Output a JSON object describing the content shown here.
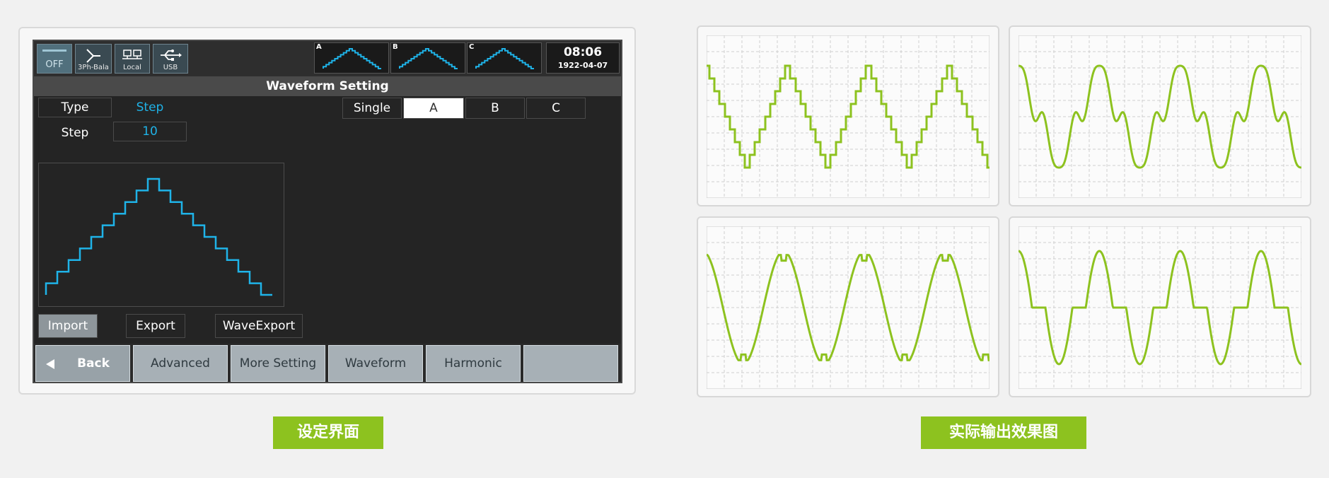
{
  "device": {
    "topbar": {
      "off_label": "OFF",
      "phase_mode_label": "3Ph-Bala",
      "local_label": "Local",
      "usb_label": "USB",
      "phase_a": "A",
      "phase_b": "B",
      "phase_c": "C",
      "time": "08:06",
      "date": "1922-04-07"
    },
    "title": "Waveform Setting",
    "type_label": "Type",
    "type_value": "Step",
    "step_label": "Step",
    "step_value": "10",
    "phase_tabs": {
      "single": "Single",
      "a": "A",
      "b": "B",
      "c": "C",
      "selected": "A"
    },
    "actions": {
      "import": "Import",
      "export": "Export",
      "waveexport": "WaveExport"
    },
    "bottom_nav": {
      "back": "Back",
      "advanced": "Advanced",
      "more_setting": "More Setting",
      "waveform": "Waveform",
      "harmonic": "Harmonic"
    },
    "wave_color": "#1fb3e8"
  },
  "captions": {
    "left": "设定界面",
    "right": "实际输出效果图"
  },
  "scope_wave_color": "#8dc21f",
  "icons": [
    "off-icon",
    "three-phase-icon",
    "local-icon",
    "usb-icon",
    "back-arrow-icon"
  ]
}
